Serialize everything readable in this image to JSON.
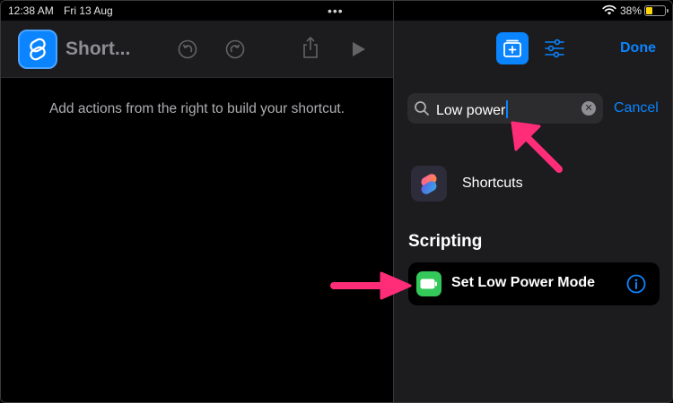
{
  "status_bar": {
    "time": "12:38 AM",
    "date": "Fri 13 Aug",
    "multitask_indicator": "•••",
    "battery_percent": "38%",
    "battery_level": 0.38
  },
  "editor": {
    "shortcut_title": "Short...",
    "hint": "Add actions from the right to build your shortcut.",
    "buttons": {
      "undo": "undo-icon",
      "redo": "redo-icon",
      "share": "share-icon",
      "play": "play-icon"
    }
  },
  "library": {
    "done_label": "Done",
    "search": {
      "value": "Low power",
      "cancel_label": "Cancel"
    },
    "apps": [
      {
        "label": "Shortcuts",
        "icon": "shortcuts-app-icon"
      }
    ],
    "section_heading": "Scripting",
    "actions": [
      {
        "label": "Set Low Power Mode",
        "icon": "battery-icon"
      }
    ]
  },
  "colors": {
    "accent": "#0a84ff",
    "annotation_arrow": "#ff2d78",
    "action_green": "#34c759",
    "battery_yellow": "#ffd60a"
  }
}
